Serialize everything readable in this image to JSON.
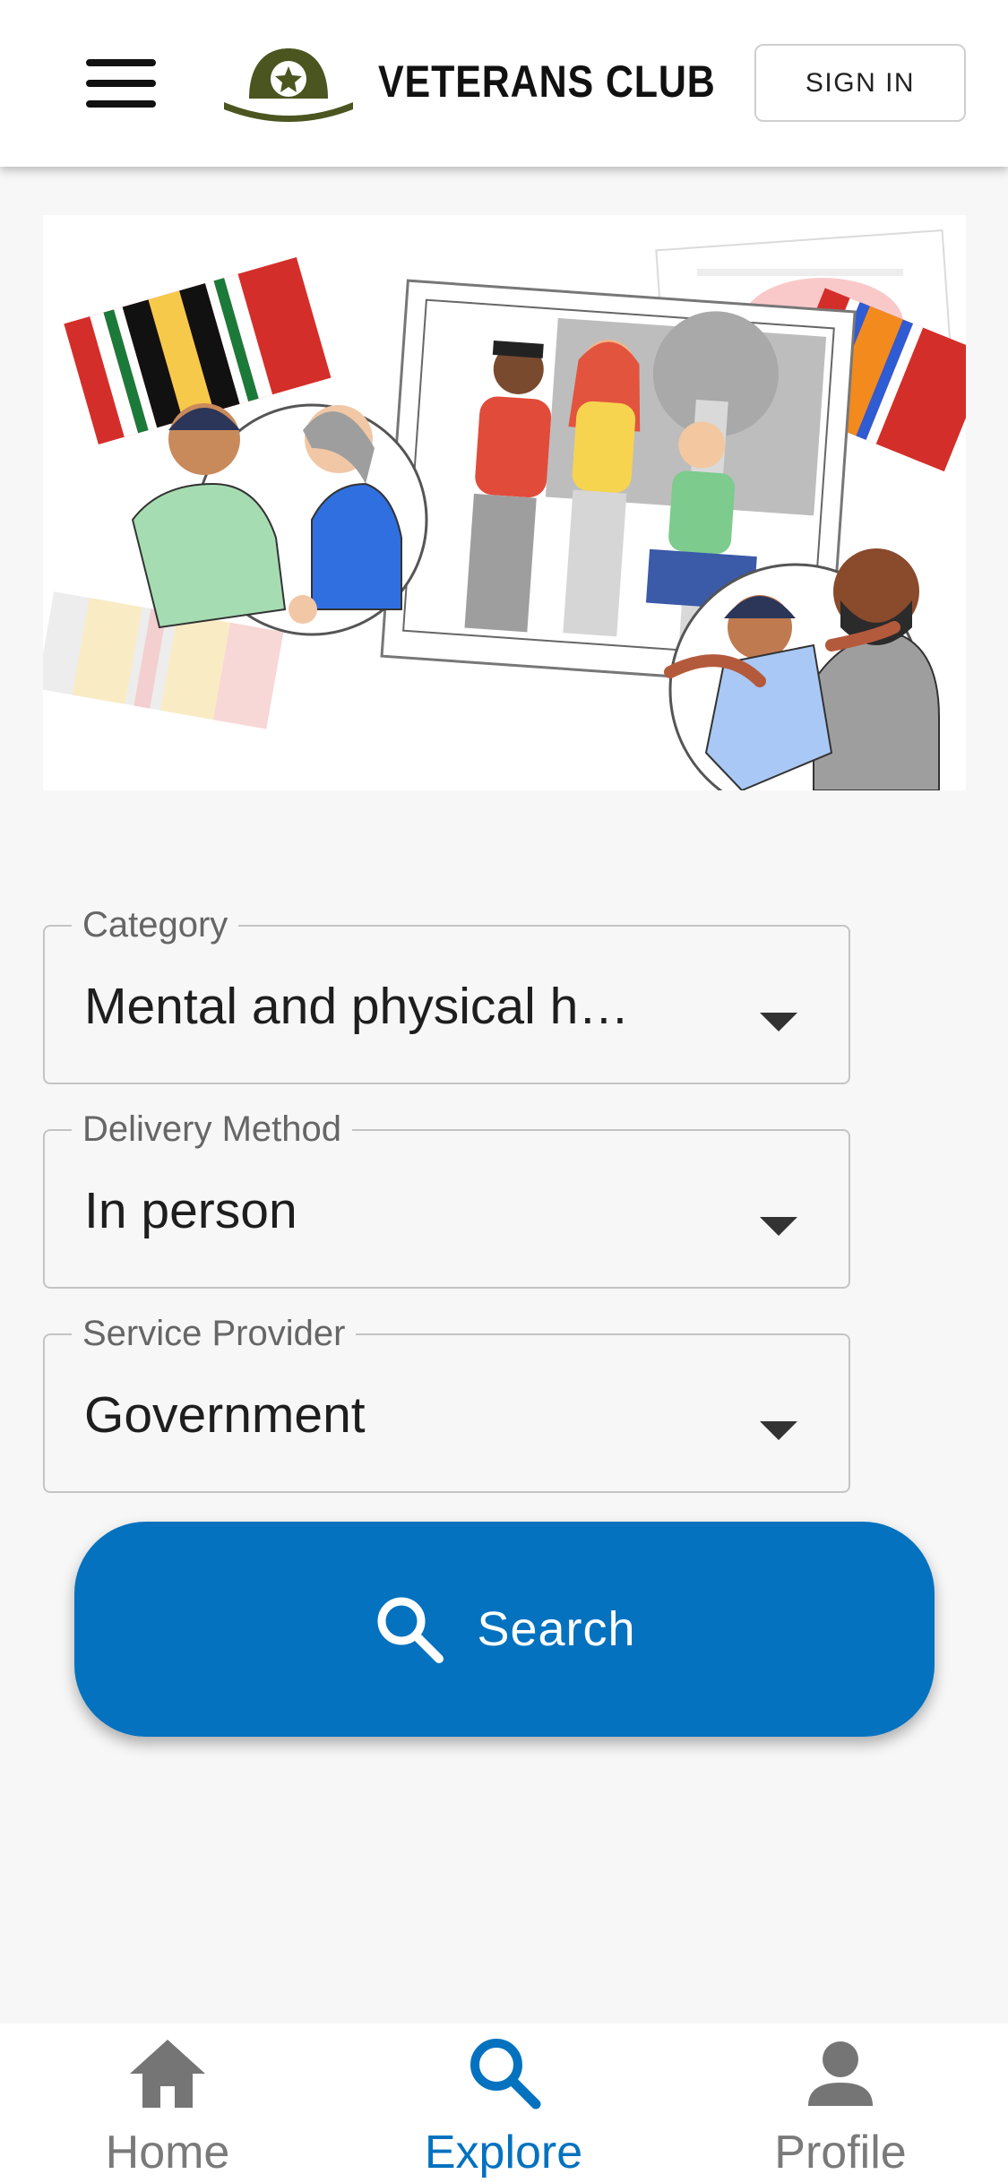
{
  "header": {
    "logo_text": "VETERANS CLUB",
    "signin_label": "SIGN IN",
    "menu_icon": "hamburger-menu-icon",
    "logo_icon": "helmet-star-icon"
  },
  "hero": {
    "illustration": "veterans-community-illustration"
  },
  "filters": [
    {
      "label": "Category",
      "value": "Mental and physical h…"
    },
    {
      "label": "Delivery Method",
      "value": "In person"
    },
    {
      "label": "Service Provider",
      "value": "Government"
    }
  ],
  "search": {
    "label": "Search",
    "icon": "search-icon"
  },
  "bottom_nav": {
    "items": [
      {
        "label": "Home",
        "icon": "home-icon",
        "active": false
      },
      {
        "label": "Explore",
        "icon": "search-icon",
        "active": true
      },
      {
        "label": "Profile",
        "icon": "person-icon",
        "active": false
      }
    ]
  },
  "colors": {
    "primary": "#0472bf",
    "logo_olive": "#4a5520",
    "nav_inactive": "#7a7a7a"
  }
}
